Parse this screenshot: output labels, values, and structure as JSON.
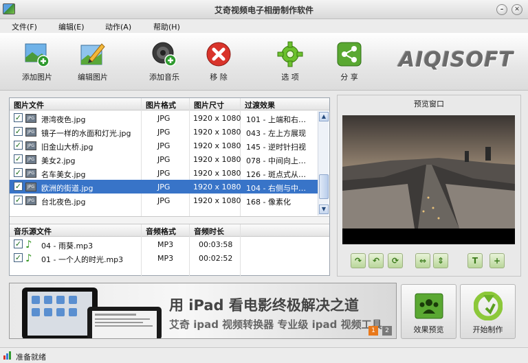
{
  "window": {
    "title": "艾奇视频电子相册制作软件"
  },
  "menu": [
    "文件(F)",
    "编辑(E)",
    "动作(A)",
    "帮助(H)"
  ],
  "toolbar": {
    "add_image": "添加图片",
    "edit_image": "编辑图片",
    "add_music": "添加音乐",
    "remove": "移 除",
    "options": "选 项",
    "share": "分 享",
    "logo": "AIQISOFT"
  },
  "image_table": {
    "headers": [
      "图片文件",
      "图片格式",
      "图片尺寸",
      "过渡效果"
    ],
    "rows": [
      {
        "file": "港湾夜色.jpg",
        "format": "JPG",
        "size": "1920 x 1080",
        "effect": "101 - 上端和右…"
      },
      {
        "file": "镜子一样的水面和灯光.jpg",
        "format": "JPG",
        "size": "1920 x 1080",
        "effect": "043 - 左上方展现"
      },
      {
        "file": "旧金山大桥.jpg",
        "format": "JPG",
        "size": "1920 x 1080",
        "effect": "145 - 逆时针扫视"
      },
      {
        "file": "美女2.jpg",
        "format": "JPG",
        "size": "1920 x 1080",
        "effect": "078 - 中间向上…"
      },
      {
        "file": "名车美女.jpg",
        "format": "JPG",
        "size": "1920 x 1080",
        "effect": "126 - 斑点式从…"
      },
      {
        "file": "欧洲的街道.jpg",
        "format": "JPG",
        "size": "1920 x 1080",
        "effect": "104 - 右侧与中…"
      },
      {
        "file": "台北夜色.jpg",
        "format": "JPG",
        "size": "1920 x 1080",
        "effect": "168 - 像素化"
      }
    ],
    "selected_index": 5
  },
  "music_table": {
    "headers": [
      "音乐源文件",
      "音频格式",
      "音频时长"
    ],
    "rows": [
      {
        "file": "04 - 雨葵.mp3",
        "format": "MP3",
        "duration": "00:03:58"
      },
      {
        "file": "01 - 一个人的时光.mp3",
        "format": "MP3",
        "duration": "00:02:52"
      }
    ]
  },
  "preview": {
    "title": "预览窗口"
  },
  "banner": {
    "title": "用 iPad 看电影终极解决之道",
    "subtitle": "艾奇 ipad 视频转换器  专业级 ipad 视频工具",
    "pages": [
      "1",
      "2"
    ]
  },
  "actions": {
    "preview": "效果预览",
    "start": "开始制作"
  },
  "status": {
    "text": "准备就绪"
  },
  "colors": {
    "selection": "#3874c8",
    "accent_green": "#5aa832",
    "remove_red": "#d9342b"
  }
}
